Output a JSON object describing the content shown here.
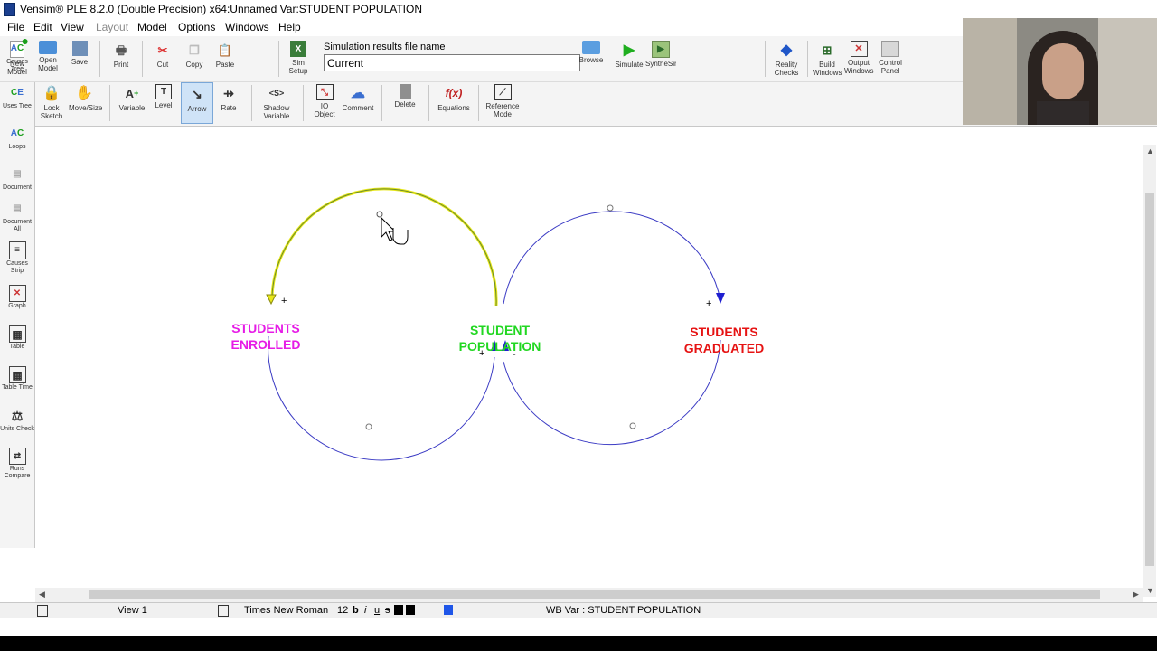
{
  "window": {
    "title": "Vensim® PLE 8.2.0 (Double Precision) x64:Unnamed Var:STUDENT POPULATION"
  },
  "menu": {
    "items": [
      "File",
      "Edit",
      "View",
      "Layout",
      "Model",
      "Options",
      "Windows",
      "Help"
    ]
  },
  "toolbar_top": {
    "new_model": "New Model",
    "open_model": "Open Model",
    "save": "Save",
    "print": "Print",
    "cut": "Cut",
    "copy": "Copy",
    "paste": "Paste",
    "sim_setup": "Sim Setup",
    "results_label": "Simulation results file name",
    "results_value": "Current",
    "browse": "Browse",
    "simulate": "Simulate",
    "synthesim": "SyntheSim",
    "reality_checks": "Reality Checks",
    "build_windows": "Build Windows",
    "output_windows": "Output Windows",
    "control_panel": "Control Panel"
  },
  "toolbar_sketch": {
    "lock_sketch": "Lock Sketch",
    "move_size": "Move/Size",
    "variable": "Variable",
    "level": "Level",
    "arrow": "Arrow",
    "rate": "Rate",
    "shadow_variable": "Shadow Variable",
    "io_object": "IO Object",
    "comment": "Comment",
    "delete": "Delete",
    "equations": "Equations",
    "reference_mode": "Reference Mode"
  },
  "sidebar": {
    "causes_tree": "Causes Tree",
    "uses_tree": "Uses Tree",
    "loops": "Loops",
    "document": "Document",
    "document_all": "Document All",
    "causes_strip": "Causes Strip",
    "graph": "Graph",
    "table": "Table",
    "table_time": "Table Time",
    "units_check": "Units Check",
    "runs_compare": "Runs Compare"
  },
  "diagram": {
    "var_enrolled": [
      "STUDENTS",
      "ENROLLED"
    ],
    "var_population": [
      "STUDENT",
      "POPULATION"
    ],
    "var_graduated": [
      "STUDENTS",
      "GRADUATED"
    ],
    "polarity_plus": "+",
    "polarity_minus": "-",
    "colors": {
      "enrolled": "#e61be6",
      "population": "#22d722",
      "graduated": "#e61313",
      "link": "#3b3bc4",
      "selected_link": "#e8e81a"
    }
  },
  "statusbar": {
    "view": "View 1",
    "font": "Times New Roman",
    "font_size": "12",
    "bold": "b",
    "italic": "i",
    "underline": "u",
    "strike": "s",
    "info": "WB Var : STUDENT POPULATION"
  }
}
